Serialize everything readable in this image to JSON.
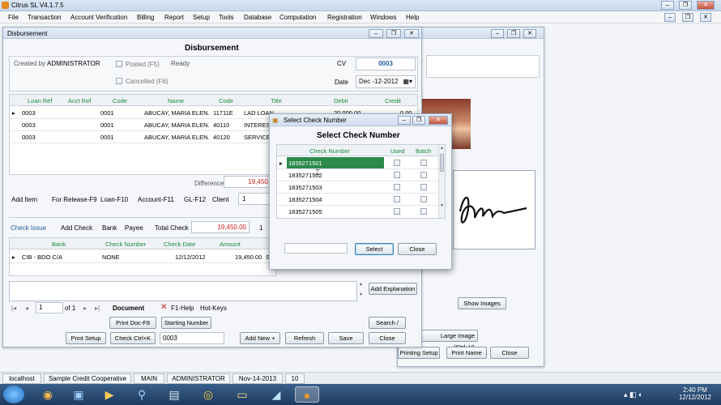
{
  "app": {
    "title": "Citrus SL V4.1.7.5"
  },
  "menu": [
    "File",
    "Transaction",
    "Account Verification",
    "Billing",
    "Report",
    "Setup",
    "Tools",
    "Database",
    "Computation",
    "Registration",
    "Windows",
    "Help"
  ],
  "disb": {
    "win_title": "Disbursement",
    "header": "Disbursement",
    "created_by_label": "Created by",
    "created_by": "ADMINISTRATOR",
    "posted_label": "Posted (F5)",
    "cancelled_label": "Cancelled (F6)",
    "status": "Ready",
    "cv_label": "CV",
    "cv_value": "0003",
    "date_label": "Date",
    "date_value": "Dec -12-2012",
    "grid_headers": [
      "Loan Ref",
      "Acct Ref",
      "Code",
      "Name",
      "Code",
      "Title",
      "Debit",
      "Credit"
    ],
    "rows": [
      [
        "0003",
        "",
        "0001",
        "ABUCAY, MARIA ELEN...",
        "11711E",
        "LAD LOAN",
        "20,000.00",
        "0.00"
      ],
      [
        "0003",
        "",
        "0001",
        "ABUCAY, MARIA ELEN...",
        "40110",
        "INTEREST",
        "",
        ""
      ],
      [
        "0003",
        "",
        "0001",
        "ABUCAY, MARIA ELEN...",
        "40120",
        "SERVICE F",
        "",
        ""
      ]
    ],
    "difference_label": "Difference",
    "difference_value": "19,450.",
    "shortcuts": [
      "Add Item",
      "For Release-F9",
      "Loan-F10",
      "Account-F11",
      "GL-F12",
      "Client"
    ],
    "client_value": "1",
    "check_issue_label": "Check Issue",
    "add_check": "Add Check",
    "bank_label": "Bank",
    "payee_label": "Payee",
    "total_check_label": "Total Check",
    "total_check": "19,450.00",
    "total_count": "1",
    "check_headers": [
      "Bank",
      "Check Number",
      "Check Date",
      "Amount"
    ],
    "check_row": [
      "CIB - BDO C/A",
      "NONE",
      "12/12/2012",
      "19,450.00",
      "Sa"
    ],
    "add_explanation": "Add Explanation",
    "nav_page": "1",
    "nav_of": "of 1",
    "document_label": "Document",
    "help_label": "F1-Help",
    "hotkeys_label": "Hot-Keys",
    "print_doc": "Print Doc-F8",
    "starting_number": "Starting Number",
    "search": "Search /",
    "print_setup": "Print Setup",
    "check_ctrl": "Check Ctrl+K",
    "check_no_value": "0003",
    "add_new": "Add New +",
    "refresh": "Refresh",
    "save": "Save",
    "close": "Close"
  },
  "right": {
    "show_images": "Show Images",
    "large_image": "Large Image (Ctrl+V)",
    "setup": "Setup",
    "print_name": "Print Name",
    "close": "Close",
    "printing_setup": "Printing Setup"
  },
  "dialog": {
    "win_title": "Select Check Number",
    "header": "Select Check Number",
    "headers": [
      "Check Number",
      "Used",
      "Batch"
    ],
    "rows": [
      "1835271501",
      "1835271502",
      "1835271503",
      "1835271504",
      "1835271505"
    ],
    "search_value": "",
    "select": "Select",
    "close": "Close"
  },
  "status": [
    "localhost",
    "Sample Credit Cooperative",
    "MAIN",
    "ADMINISTRATOR",
    "Nov-14-2013",
    "10"
  ],
  "clock": {
    "time": "2:40 PM",
    "date": "12/12/2012"
  }
}
